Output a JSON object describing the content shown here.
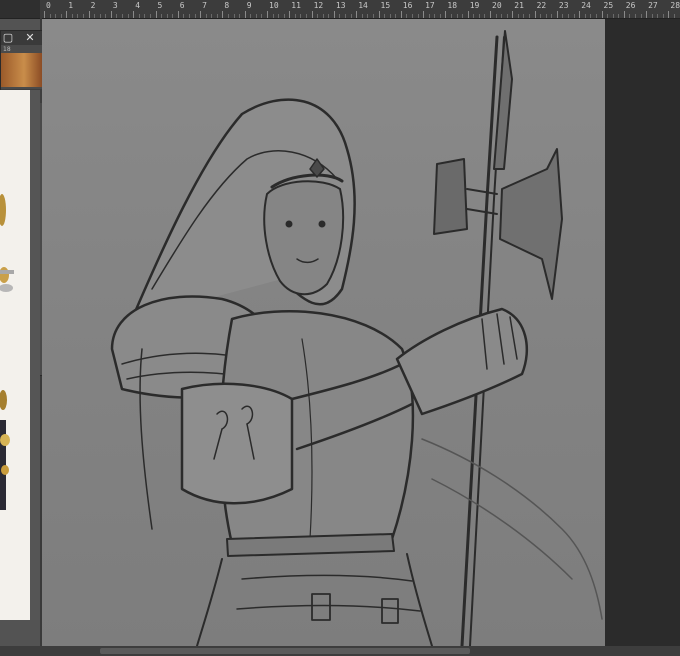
{
  "ruler": {
    "labels": [
      "0",
      "1",
      "2",
      "3",
      "4",
      "5",
      "6",
      "7",
      "8",
      "9",
      "10",
      "11",
      "12",
      "13",
      "14",
      "15",
      "16",
      "17",
      "18",
      "19",
      "20",
      "21",
      "22",
      "23",
      "24",
      "25",
      "26",
      "27",
      "28"
    ]
  },
  "ref_panel": {
    "close_glyph": "✕",
    "second_close_glyph": "✕",
    "tab_number": "18"
  },
  "colors": {
    "workspace": "#535353",
    "canvas_gray": "#848484",
    "pasteboard": "#2b2b2b",
    "line_art": "#2a2a2a"
  }
}
